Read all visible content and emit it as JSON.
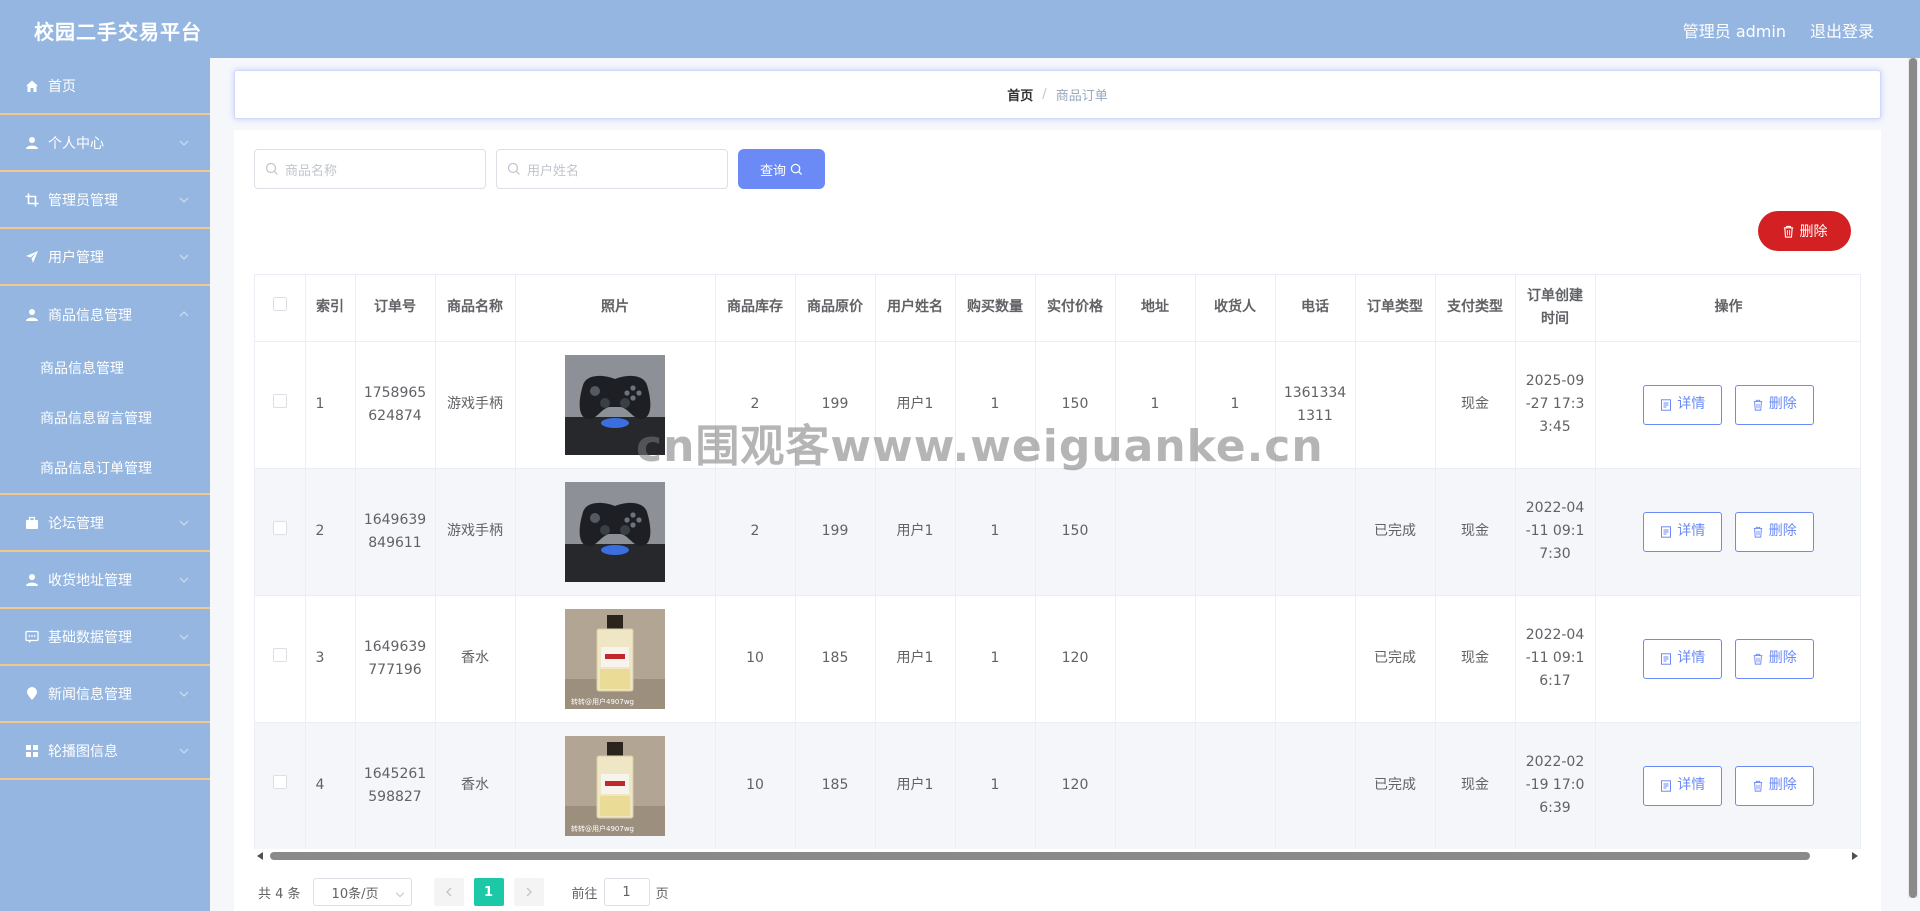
{
  "header": {
    "brand": "校园二手交易平台",
    "user_label": "管理员 admin",
    "logout_label": "退出登录"
  },
  "sidebar": {
    "items": [
      {
        "label": "首页",
        "icon": "home-icon"
      },
      {
        "label": "个人中心",
        "icon": "user-icon"
      },
      {
        "label": "管理员管理",
        "icon": "crop-icon"
      },
      {
        "label": "用户管理",
        "icon": "send-icon"
      },
      {
        "label": "商品信息管理",
        "icon": "user-icon"
      },
      {
        "label": "论坛管理",
        "icon": "suitcase-icon"
      },
      {
        "label": "收货地址管理",
        "icon": "user-icon"
      },
      {
        "label": "基础数据管理",
        "icon": "chat-icon"
      },
      {
        "label": "新闻信息管理",
        "icon": "location-icon"
      },
      {
        "label": "轮播图信息",
        "icon": "grid-icon"
      }
    ],
    "submenu": [
      "商品信息管理",
      "商品信息留言管理",
      "商品信息订单管理"
    ]
  },
  "breadcrumb": {
    "home": "首页",
    "current": "商品订单"
  },
  "search": {
    "product_placeholder": "商品名称",
    "user_placeholder": "用户姓名",
    "query_label": "查询"
  },
  "actions": {
    "delete_label": "删除"
  },
  "table": {
    "headers": [
      "索引",
      "订单号",
      "商品名称",
      "照片",
      "商品库存",
      "商品原价",
      "用户姓名",
      "购买数量",
      "实付价格",
      "地址",
      "收货人",
      "电话",
      "订单类型",
      "支付类型",
      "订单创建时间",
      "操作"
    ],
    "detail_label": "详情",
    "delete_label": "删除",
    "rows": [
      {
        "index": "1",
        "order_no": "1758965624874",
        "product": "游戏手柄",
        "photo": "gamepad",
        "stock": "2",
        "price": "199",
        "user": "用户1",
        "qty": "1",
        "paid": "150",
        "address": "1",
        "receiver": "1",
        "phone": "13613341311",
        "order_type": "",
        "pay_type": "现金",
        "created": "2025-09-27 17:33:45"
      },
      {
        "index": "2",
        "order_no": "1649639849611",
        "product": "游戏手柄",
        "photo": "gamepad",
        "stock": "2",
        "price": "199",
        "user": "用户1",
        "qty": "1",
        "paid": "150",
        "address": "",
        "receiver": "",
        "phone": "",
        "order_type": "已完成",
        "pay_type": "现金",
        "created": "2022-04-11 09:17:30"
      },
      {
        "index": "3",
        "order_no": "1649639777196",
        "product": "香水",
        "photo": "perfume",
        "stock": "10",
        "price": "185",
        "user": "用户1",
        "qty": "1",
        "paid": "120",
        "address": "",
        "receiver": "",
        "phone": "",
        "order_type": "已完成",
        "pay_type": "现金",
        "created": "2022-04-11 09:16:17"
      },
      {
        "index": "4",
        "order_no": "1645261598827",
        "product": "香水",
        "photo": "perfume",
        "stock": "10",
        "price": "185",
        "user": "用户1",
        "qty": "1",
        "paid": "120",
        "address": "",
        "receiver": "",
        "phone": "",
        "order_type": "已完成",
        "pay_type": "现金",
        "created": "2022-02-19 17:06:39"
      }
    ]
  },
  "pagination": {
    "total": "共 4 条",
    "page_size": "10条/页",
    "current_page": "1",
    "goto_label": "前往",
    "goto_value": "1",
    "page_unit": "页"
  },
  "photo_caption": "转转@用户4907wg",
  "watermark": "cn围观客www.weiguanke.cn",
  "colors": {
    "header_bg": "#94b6e0",
    "accent": "#6b8af6",
    "danger": "#d32023",
    "pager_active": "#1cc8a5",
    "menu_divider": "#f3c98b"
  }
}
